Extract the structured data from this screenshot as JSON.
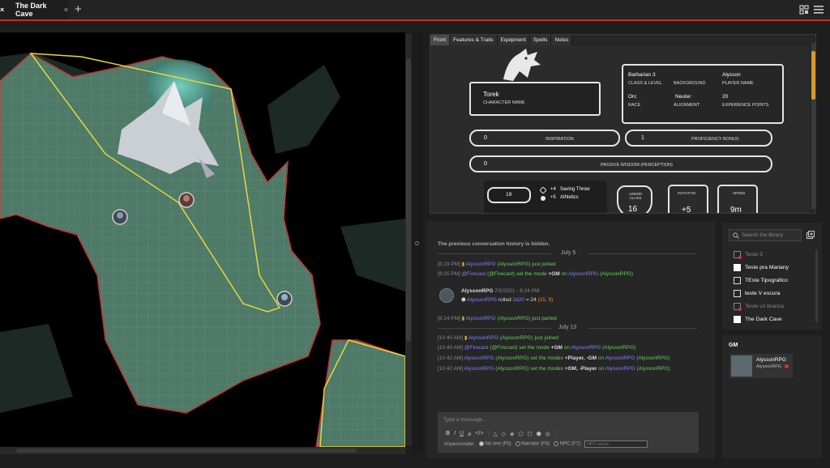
{
  "tabs": {
    "active_label": "The Dark Cave",
    "close_glyph": "×",
    "add_glyph": "+"
  },
  "sheet": {
    "tabs": [
      "Front",
      "Features & Traits",
      "Equipment",
      "Spells",
      "Notes"
    ],
    "character_name": "Torek",
    "character_name_label": "CHARACTER NAME",
    "class_level": "Barbarian 3",
    "class_level_label": "CLASS & LEVEL",
    "background": "",
    "background_label": "BACKGROUND",
    "player_name": "Alysson",
    "player_name_label": "PLAYER NAME",
    "race": "Orc",
    "race_label": "RACE",
    "alignment": "Neuter",
    "alignment_label": "ALIGNMENT",
    "xp": "20",
    "xp_label": "EXPERIENCE POINTS",
    "inspiration": "0",
    "inspiration_label": "INSPIRATION",
    "proficiency": "1",
    "proficiency_label": "PROFICIENCY BONUS",
    "passive": "0",
    "passive_label": "PASSIVE WISDOM (PERCEPTION)",
    "stat_value": "19",
    "save_bonus": "+4",
    "save_label": "Saving Throw",
    "athletics_bonus": "+5",
    "athletics_label": "Athletics",
    "ac_label": "ARMOR CLASS",
    "ac_value": "16",
    "init_label": "INITIATIVE",
    "init_value": "+5",
    "speed_label": "SPEED",
    "speed_value": "9m"
  },
  "chat": {
    "hidden_notice": "The previous conversation history is hidden.",
    "date1": "July 5",
    "date2": "July 13",
    "l1_time": "[8:23 PM]",
    "l1_user": "AlyssonRPG",
    "l1_paren": "(AlyssonRPG)",
    "l1_text": "just joined",
    "l2_time": "[8:25 PM]",
    "l2_a": "@Firecast",
    "l2_b": "(@Firecast) set the mode",
    "l2_c": "+GM",
    "l2_d": "on",
    "l2_e": "AlyssonRPG",
    "l2_f": "(AlyssonRPG)",
    "roll_user": "AlyssonRPG",
    "roll_date": "7/5/2021 - 8:24 PM",
    "roll_name": "AlyssonRPG",
    "roll_text": "rolled",
    "roll_dice": "2d20",
    "roll_eq": "= 24",
    "roll_detail": "(15, 9)",
    "l3_time": "[8:24 PM]",
    "l3_user": "AlyssonRPG",
    "l3_paren": "(AlyssonRPG)",
    "l3_text": "just parted",
    "l4_time": "[10:40 AM]",
    "l4_user": "AlyssonRPG",
    "l4_paren": "(AlyssonRPG)",
    "l4_text": "just joined",
    "l5_time": "[10:40 AM]",
    "l5_a": "@Firecast",
    "l5_b": "(@Firecast) set the mode",
    "l5_c": "+GM",
    "l5_d": "on",
    "l5_e": "AlyssonRPG",
    "l5_f": "(AlyssonRPG)",
    "l6_time": "[10:42 AM]",
    "l6_a": "AlyssonRPG",
    "l6_b": "(AlyssonRPG) set the modes",
    "l6_c": "+Player, -GM",
    "l6_d": "on",
    "l6_e": "AlyssonRPG",
    "l6_f": "(AlyssonRPG)",
    "l7_time": "[10:42 AM]",
    "l7_a": "AlyssonRPG",
    "l7_b": "(AlyssonRPG) set the modes",
    "l7_c": "+GM, -Player",
    "l7_d": "on",
    "l7_e": "AlyssonRPG",
    "l7_f": "(AlyssonRPG)",
    "input_placeholder": "Type a message...",
    "impersonate_label": "Impersonate:",
    "opt_noone": "No one (F5)",
    "opt_narrator": "Narrator (F6)",
    "opt_npc": "NPC (F7)",
    "npc_placeholder": "NPC name"
  },
  "library": {
    "search_placeholder": "Search the library",
    "items": [
      {
        "label": "Teste 3",
        "dim": true
      },
      {
        "label": "Teste pra Mariany",
        "dim": false
      },
      {
        "label": "TEste Tipografico",
        "dim": false
      },
      {
        "label": "teste V escura",
        "dim": false
      },
      {
        "label": "Teste v3 branca",
        "dim": true
      },
      {
        "label": "The Dark Cave",
        "dim": false
      }
    ]
  },
  "gm": {
    "title": "GM",
    "user": "AlyssonRPG",
    "sub": "AlyssonRPG"
  },
  "colors": {
    "accent": "#c0302b",
    "chat_green": "#67d05c",
    "chat_blue": "#7c83ff",
    "scroll_thumb": "#d49a2a"
  }
}
